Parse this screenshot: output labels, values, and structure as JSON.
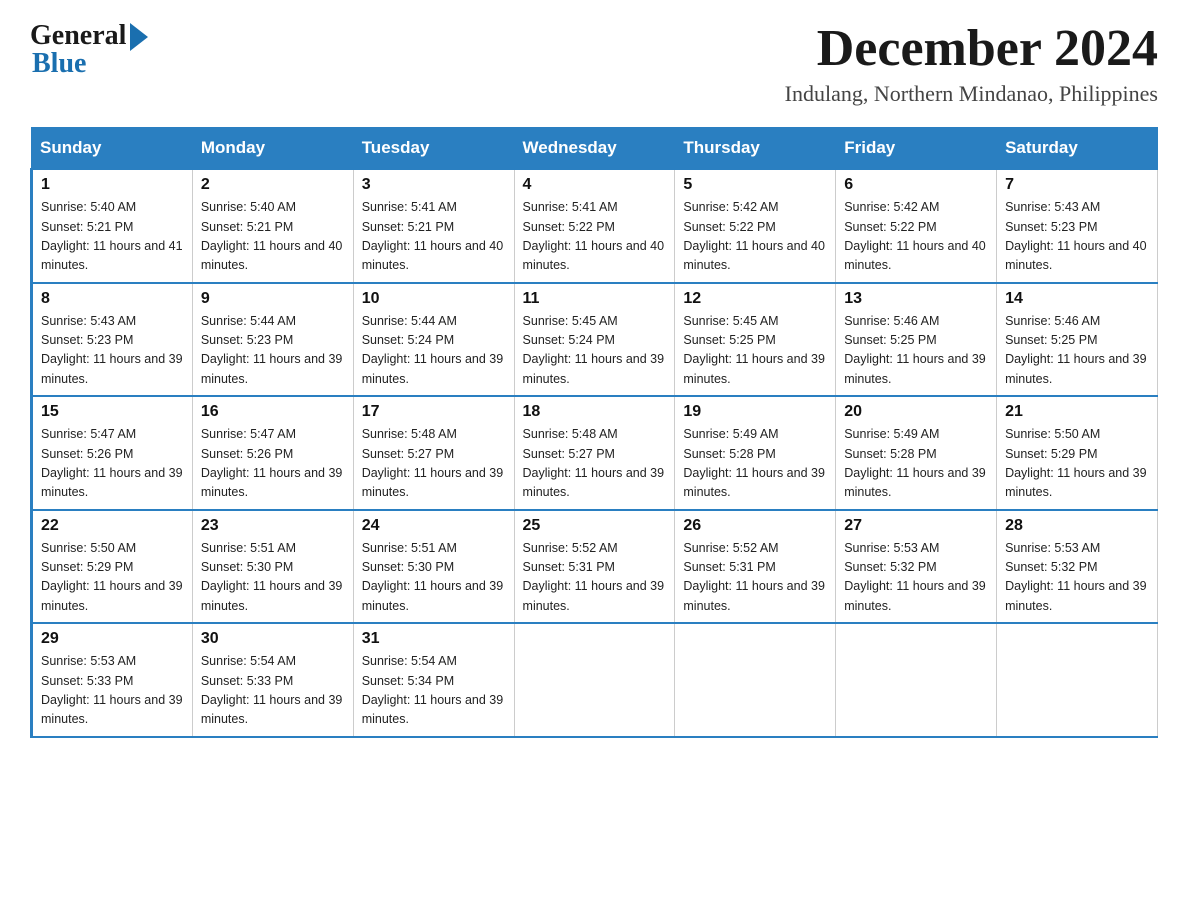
{
  "logo": {
    "general": "General",
    "blue": "Blue"
  },
  "header": {
    "month_year": "December 2024",
    "location": "Indulang, Northern Mindanao, Philippines"
  },
  "days_of_week": [
    "Sunday",
    "Monday",
    "Tuesday",
    "Wednesday",
    "Thursday",
    "Friday",
    "Saturday"
  ],
  "weeks": [
    [
      {
        "day": 1,
        "sunrise": "5:40 AM",
        "sunset": "5:21 PM",
        "daylight": "11 hours and 41 minutes."
      },
      {
        "day": 2,
        "sunrise": "5:40 AM",
        "sunset": "5:21 PM",
        "daylight": "11 hours and 40 minutes."
      },
      {
        "day": 3,
        "sunrise": "5:41 AM",
        "sunset": "5:21 PM",
        "daylight": "11 hours and 40 minutes."
      },
      {
        "day": 4,
        "sunrise": "5:41 AM",
        "sunset": "5:22 PM",
        "daylight": "11 hours and 40 minutes."
      },
      {
        "day": 5,
        "sunrise": "5:42 AM",
        "sunset": "5:22 PM",
        "daylight": "11 hours and 40 minutes."
      },
      {
        "day": 6,
        "sunrise": "5:42 AM",
        "sunset": "5:22 PM",
        "daylight": "11 hours and 40 minutes."
      },
      {
        "day": 7,
        "sunrise": "5:43 AM",
        "sunset": "5:23 PM",
        "daylight": "11 hours and 40 minutes."
      }
    ],
    [
      {
        "day": 8,
        "sunrise": "5:43 AM",
        "sunset": "5:23 PM",
        "daylight": "11 hours and 39 minutes."
      },
      {
        "day": 9,
        "sunrise": "5:44 AM",
        "sunset": "5:23 PM",
        "daylight": "11 hours and 39 minutes."
      },
      {
        "day": 10,
        "sunrise": "5:44 AM",
        "sunset": "5:24 PM",
        "daylight": "11 hours and 39 minutes."
      },
      {
        "day": 11,
        "sunrise": "5:45 AM",
        "sunset": "5:24 PM",
        "daylight": "11 hours and 39 minutes."
      },
      {
        "day": 12,
        "sunrise": "5:45 AM",
        "sunset": "5:25 PM",
        "daylight": "11 hours and 39 minutes."
      },
      {
        "day": 13,
        "sunrise": "5:46 AM",
        "sunset": "5:25 PM",
        "daylight": "11 hours and 39 minutes."
      },
      {
        "day": 14,
        "sunrise": "5:46 AM",
        "sunset": "5:25 PM",
        "daylight": "11 hours and 39 minutes."
      }
    ],
    [
      {
        "day": 15,
        "sunrise": "5:47 AM",
        "sunset": "5:26 PM",
        "daylight": "11 hours and 39 minutes."
      },
      {
        "day": 16,
        "sunrise": "5:47 AM",
        "sunset": "5:26 PM",
        "daylight": "11 hours and 39 minutes."
      },
      {
        "day": 17,
        "sunrise": "5:48 AM",
        "sunset": "5:27 PM",
        "daylight": "11 hours and 39 minutes."
      },
      {
        "day": 18,
        "sunrise": "5:48 AM",
        "sunset": "5:27 PM",
        "daylight": "11 hours and 39 minutes."
      },
      {
        "day": 19,
        "sunrise": "5:49 AM",
        "sunset": "5:28 PM",
        "daylight": "11 hours and 39 minutes."
      },
      {
        "day": 20,
        "sunrise": "5:49 AM",
        "sunset": "5:28 PM",
        "daylight": "11 hours and 39 minutes."
      },
      {
        "day": 21,
        "sunrise": "5:50 AM",
        "sunset": "5:29 PM",
        "daylight": "11 hours and 39 minutes."
      }
    ],
    [
      {
        "day": 22,
        "sunrise": "5:50 AM",
        "sunset": "5:29 PM",
        "daylight": "11 hours and 39 minutes."
      },
      {
        "day": 23,
        "sunrise": "5:51 AM",
        "sunset": "5:30 PM",
        "daylight": "11 hours and 39 minutes."
      },
      {
        "day": 24,
        "sunrise": "5:51 AM",
        "sunset": "5:30 PM",
        "daylight": "11 hours and 39 minutes."
      },
      {
        "day": 25,
        "sunrise": "5:52 AM",
        "sunset": "5:31 PM",
        "daylight": "11 hours and 39 minutes."
      },
      {
        "day": 26,
        "sunrise": "5:52 AM",
        "sunset": "5:31 PM",
        "daylight": "11 hours and 39 minutes."
      },
      {
        "day": 27,
        "sunrise": "5:53 AM",
        "sunset": "5:32 PM",
        "daylight": "11 hours and 39 minutes."
      },
      {
        "day": 28,
        "sunrise": "5:53 AM",
        "sunset": "5:32 PM",
        "daylight": "11 hours and 39 minutes."
      }
    ],
    [
      {
        "day": 29,
        "sunrise": "5:53 AM",
        "sunset": "5:33 PM",
        "daylight": "11 hours and 39 minutes."
      },
      {
        "day": 30,
        "sunrise": "5:54 AM",
        "sunset": "5:33 PM",
        "daylight": "11 hours and 39 minutes."
      },
      {
        "day": 31,
        "sunrise": "5:54 AM",
        "sunset": "5:34 PM",
        "daylight": "11 hours and 39 minutes."
      },
      null,
      null,
      null,
      null
    ]
  ]
}
